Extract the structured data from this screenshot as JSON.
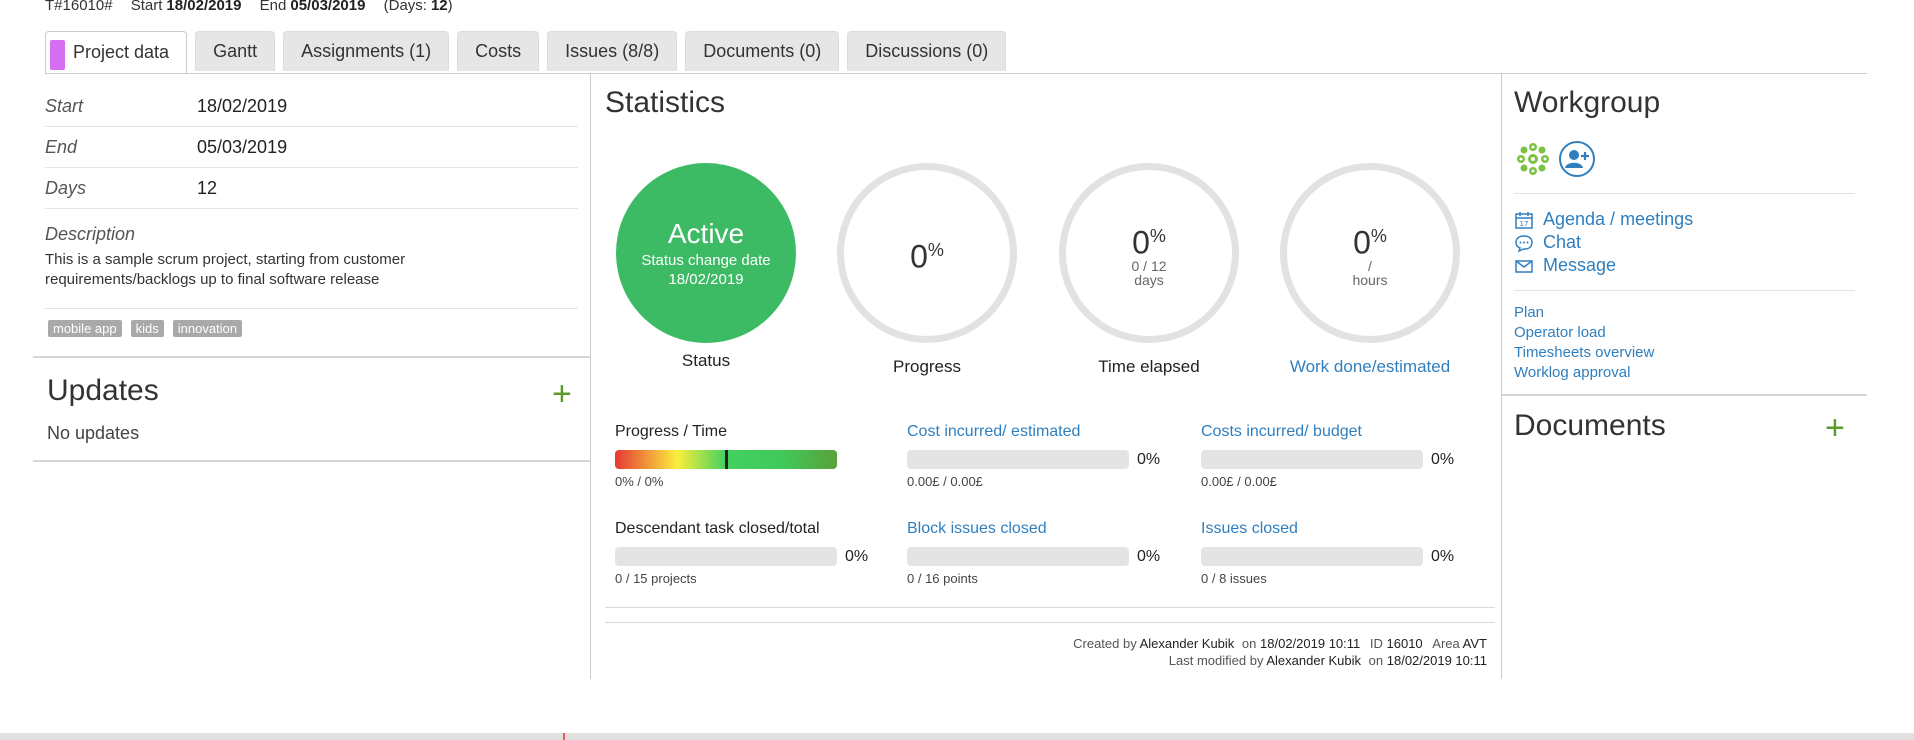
{
  "header": {
    "code": "T#16010#",
    "start_label": "Start",
    "start_value": "18/02/2019",
    "end_label": "End",
    "end_value": "05/03/2019",
    "days_label": "(Days:",
    "days_value": "12",
    "days_close": ")"
  },
  "tabs": [
    {
      "label": "Project data"
    },
    {
      "label": "Gantt"
    },
    {
      "label": "Assignments (1)"
    },
    {
      "label": "Costs"
    },
    {
      "label": "Issues (8/8)"
    },
    {
      "label": "Documents (0)"
    },
    {
      "label": "Discussions (0)"
    }
  ],
  "project": {
    "start_label": "Start",
    "start": "18/02/2019",
    "end_label": "End",
    "end": "05/03/2019",
    "days_label": "Days",
    "days": "12",
    "description_label": "Description",
    "description": "This is a sample scrum project, starting from customer requirements/backlogs up to final software release",
    "tags": [
      "mobile app",
      "kids",
      "innovation"
    ]
  },
  "updates": {
    "title": "Updates",
    "empty": "No updates"
  },
  "statistics": {
    "title": "Statistics",
    "status": {
      "value": "Active",
      "sub": "Status change date",
      "date": "18/02/2019",
      "label": "Status"
    },
    "progress": {
      "value": "0",
      "unit": "%",
      "label": "Progress"
    },
    "time_elapsed": {
      "value": "0",
      "unit": "%",
      "sub1": "0 / 12",
      "sub2": "days",
      "label": "Time elapsed"
    },
    "work_done": {
      "value": "0",
      "unit": "%",
      "sub1": "/",
      "sub2": "hours",
      "label": "Work done/estimated"
    },
    "metrics": {
      "progress_time": {
        "title": "Progress / Time",
        "sub": "0% / 0%",
        "marker": 0.5
      },
      "cost_estimated": {
        "title": "Cost incurred/ estimated",
        "pct": "0%",
        "sub": "0.00£ / 0.00£"
      },
      "cost_budget": {
        "title": "Costs incurred/ budget",
        "pct": "0%",
        "sub": "0.00£ / 0.00£"
      },
      "descendant": {
        "title": "Descendant task closed/total",
        "pct": "0%",
        "sub": "0 / 15 projects"
      },
      "block_issues": {
        "title": "Block issues closed",
        "pct": "0%",
        "sub": "0 / 16 points"
      },
      "issues_closed": {
        "title": "Issues closed",
        "pct": "0%",
        "sub": "0 / 8 issues"
      }
    },
    "footer": {
      "created_by_label": "Created by",
      "created_by": "Alexander Kubik",
      "on_label": "on",
      "created_on": "18/02/2019 10:11",
      "id_label": "ID",
      "id": "16010",
      "area_label": "Area",
      "area": "AVT",
      "modified_by_label": "Last modified by",
      "modified_by": "Alexander Kubik",
      "modified_on": "18/02/2019 10:11"
    }
  },
  "workgroup": {
    "title": "Workgroup",
    "links": [
      {
        "label": "Agenda / meetings",
        "icon": "calendar-icon"
      },
      {
        "label": "Chat",
        "icon": "chat-icon"
      },
      {
        "label": "Message",
        "icon": "envelope-icon"
      }
    ],
    "small_links": [
      "Plan",
      "Operator load",
      "Timesheets overview",
      "Worklog approval"
    ]
  },
  "documents": {
    "title": "Documents"
  },
  "colors": {
    "accent": "#2f7fbf",
    "active": "#3dba64",
    "add": "#5b9a2b",
    "tab_marker": "#d56ef2"
  }
}
